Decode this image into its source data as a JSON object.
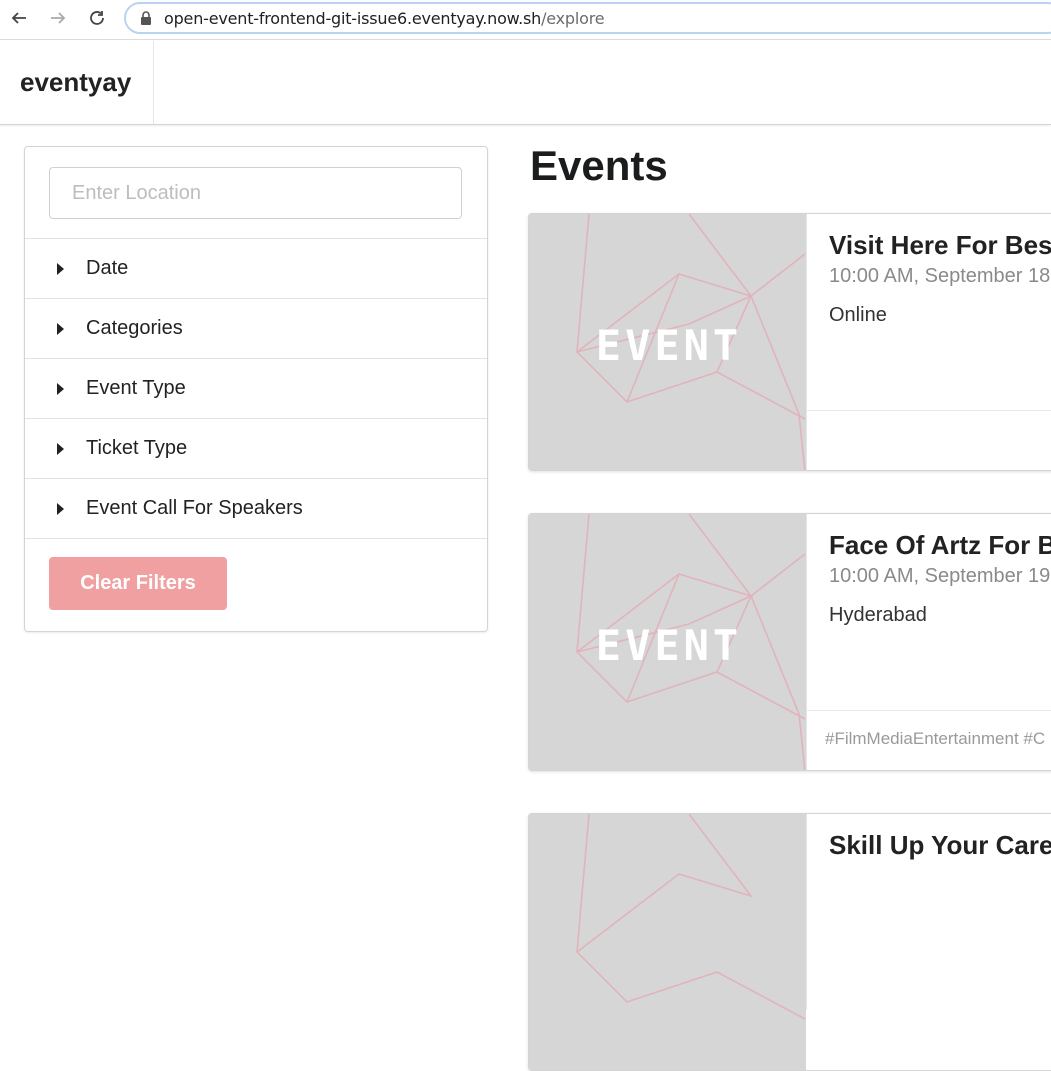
{
  "browser": {
    "url_host": "open-event-frontend-git-issue6.eventyay.now.sh",
    "url_path": "/explore"
  },
  "header": {
    "brand": "eventyay"
  },
  "filters": {
    "location_placeholder": "Enter Location",
    "items": [
      "Date",
      "Categories",
      "Event Type",
      "Ticket Type",
      "Event Call For Speakers"
    ],
    "clear_label": "Clear Filters"
  },
  "main": {
    "title": "Events",
    "image_label": "EVENT",
    "events": [
      {
        "title": "Visit Here For Best",
        "time": "10:00 AM, September 18",
        "location": "Online",
        "tags": ""
      },
      {
        "title": "Face Of Artz For Bu",
        "time": "10:00 AM, September 19",
        "location": "Hyderabad",
        "tags": "#FilmMediaEntertainment #C"
      },
      {
        "title": "Skill Up Your Caree",
        "time": "",
        "location": "",
        "tags": ""
      }
    ]
  },
  "colors": {
    "clear_button": "#f0a0a0",
    "card_image_bg": "#d6d6d6",
    "image_lines": "#e3b0b8"
  }
}
